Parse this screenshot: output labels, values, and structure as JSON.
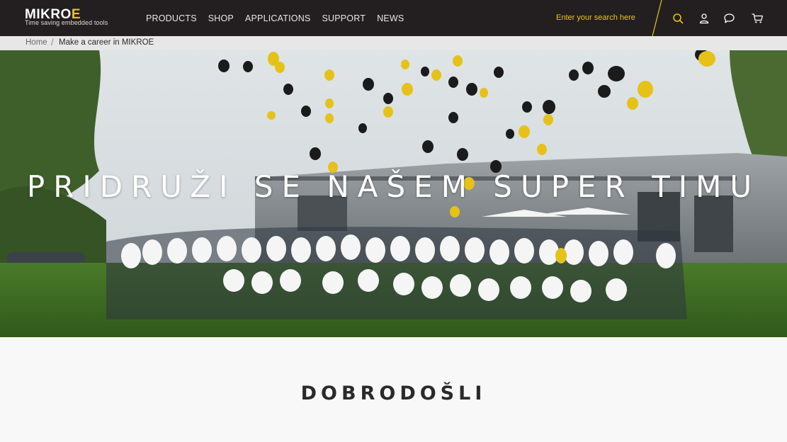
{
  "header": {
    "logo_word_main": "MIKRO",
    "logo_word_accent": "E",
    "logo_tagline": "Time saving embedded tools",
    "nav": [
      "PRODUCTS",
      "SHOP",
      "APPLICATIONS",
      "SUPPORT",
      "NEWS"
    ],
    "search": {
      "placeholder": "Enter your search here",
      "value": ""
    },
    "icons": [
      "search-icon",
      "user-icon",
      "chat-icon",
      "cart-icon"
    ]
  },
  "breadcrumb": {
    "home": "Home",
    "separator": "/",
    "current": "Make a career in MIKROE"
  },
  "hero": {
    "title": "PRIDRUŽI SE NAŠEM SUPER TIMU"
  },
  "welcome": {
    "title": "DOBRODOŠLI"
  },
  "colors": {
    "header_bg": "#231f20",
    "accent": "#ebc614",
    "breadcrumb_bg": "#e7e7e7",
    "page_bg": "#f8f8f8"
  }
}
